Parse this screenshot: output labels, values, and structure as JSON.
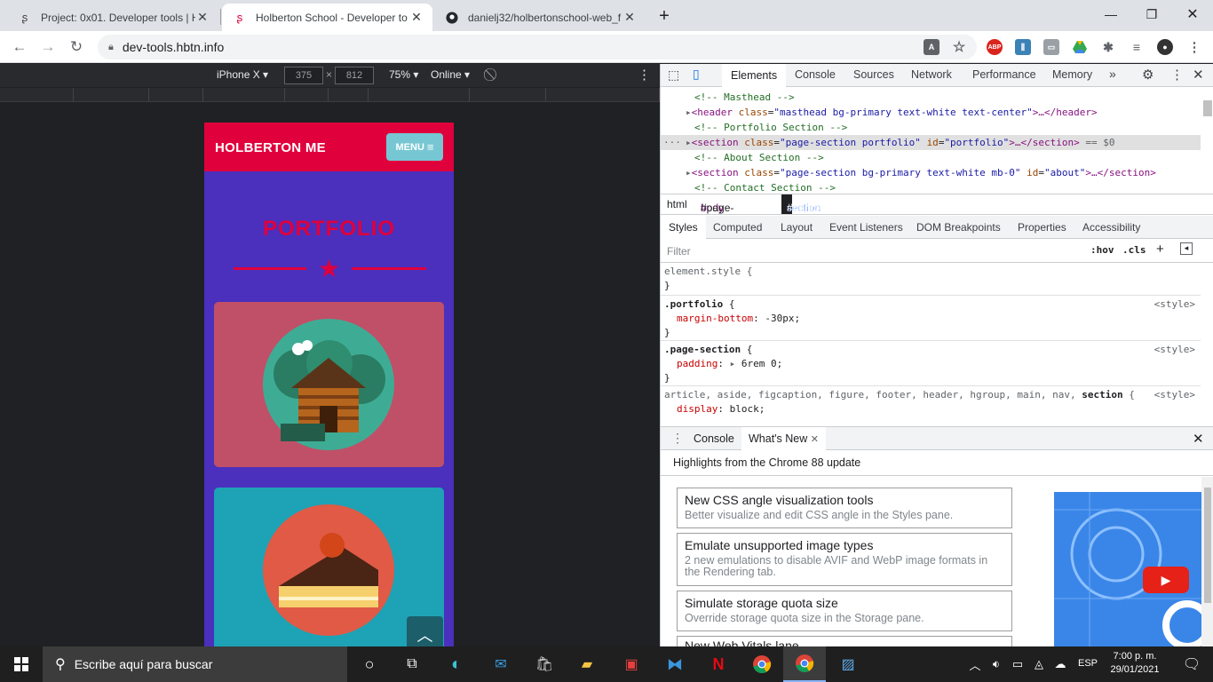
{
  "browser": {
    "tabs": [
      {
        "title": "Project: 0x01. Developer tools | H",
        "favicon": "holberton-logo-icon"
      },
      {
        "title": "Holberton School - Developer to",
        "favicon": "holberton-logo-icon"
      },
      {
        "title": "danielj32/holbertonschool-web_f",
        "favicon": "github-icon"
      }
    ],
    "url": "dev-tools.hbtn.info"
  },
  "device_toolbar": {
    "device": "iPhone X",
    "width": "375",
    "height": "812",
    "zoom": "75%",
    "network": "Online"
  },
  "site": {
    "brand": "HOLBERTON ME",
    "menu_label": "MENU",
    "section_title": "PORTFOLIO",
    "colors": {
      "primary": "#e0003c",
      "background": "#4b2fbd",
      "menu": "#76c7d3",
      "card1": "#c05067",
      "card2": "#1ea2b5"
    }
  },
  "devtools": {
    "tabs": [
      "Elements",
      "Console",
      "Sources",
      "Network",
      "Performance",
      "Memory"
    ],
    "dom": {
      "c1": "<!-- Masthead -->",
      "l2_tag": "<header",
      "l2_attr": "class",
      "l2_val": "\"masthead bg-primary text-white text-center\"",
      "l2_end": ">…</header>",
      "c3": "<!-- Portfolio Section -->",
      "l4_tag": "<section",
      "l4_a1": "class",
      "l4_v1": "\"page-section portfolio\"",
      "l4_a2": "id",
      "l4_v2": "\"portfolio\"",
      "l4_end": ">…</section>",
      "l4_sel": "== $0",
      "c5": "<!-- About Section -->",
      "l6_tag": "<section",
      "l6_a1": "class",
      "l6_v1": "\"page-section bg-primary text-white mb-0\"",
      "l6_a2": "id",
      "l6_v2": "\"about\"",
      "l6_end": ">…</section>",
      "c7": "<!-- Contact Section -->"
    },
    "breadcrumbs": {
      "b1": "html",
      "b2_tag": "body",
      "b2_id": "#page-top",
      "b3_tag": "section",
      "b3_rest": "#portfolio.page-section.portfolio"
    },
    "styles_tabs": [
      "Styles",
      "Computed",
      "Layout",
      "Event Listeners",
      "DOM Breakpoints",
      "Properties",
      "Accessibility"
    ],
    "filter_placeholder": "Filter",
    "hov": ":hov",
    "cls": ".cls",
    "rules": {
      "r1_sel": "element.style {",
      "r2_sel": ".portfolio",
      "r2_prop": "margin-bottom",
      "r2_val": "-30px;",
      "r3_sel": ".page-section",
      "r3_prop": "padding",
      "r3_val": "6rem 0;",
      "r4_sel": "article, aside, figcaption, figure, footer, header, hgroup, main, nav,",
      "r4_last": "section",
      "r4_prop": "display",
      "r4_val": "block;",
      "source": "<style>",
      "open": "{",
      "close": "}"
    },
    "drawer": {
      "tabs": [
        "Console",
        "What's New"
      ],
      "header": "Highlights from the Chrome 88 update",
      "items": [
        {
          "title": "New CSS angle visualization tools",
          "desc": "Better visualize and edit CSS angle in the Styles pane."
        },
        {
          "title": "Emulate unsupported image types",
          "desc": "2 new emulations to disable AVIF and WebP image formats in the Rendering tab."
        },
        {
          "title": "Simulate storage quota size",
          "desc": "Override storage quota size in the Storage pane."
        },
        {
          "title": "New Web Vitals lane",
          "desc": ""
        }
      ]
    }
  },
  "taskbar": {
    "search_placeholder": "Escribe aquí para buscar",
    "language": "ESP",
    "time": "7:00 p. m.",
    "date": "29/01/2021"
  }
}
